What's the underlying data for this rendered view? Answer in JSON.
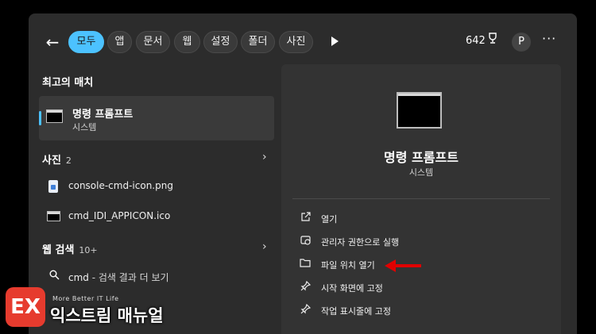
{
  "topbar": {
    "back_label": "←",
    "filters": [
      "모두",
      "앱",
      "문서",
      "웹",
      "설정",
      "폴더",
      "사진"
    ],
    "active_filter": "모두",
    "points": "642",
    "avatar_initial": "P",
    "more_label": "···"
  },
  "left": {
    "best_match_title": "최고의 매치",
    "best_match": {
      "name": "명령 프롬프트",
      "subtitle": "시스템"
    },
    "photos": {
      "title": "사진",
      "count": "2",
      "items": [
        "console-cmd-icon.png",
        "cmd_IDI_APPICON.ico"
      ]
    },
    "web": {
      "title": "웹 검색",
      "count": "10+",
      "query": "cmd",
      "suffix": " - 검색 결과 더 보기"
    }
  },
  "right": {
    "title": "명령 프롬프트",
    "subtitle": "시스템",
    "actions": [
      {
        "icon": "open-external-icon",
        "label": "열기"
      },
      {
        "icon": "admin-shield-icon",
        "label": "관리자 권한으로 실행"
      },
      {
        "icon": "folder-icon",
        "label": "파일 위치 열기"
      },
      {
        "icon": "pin-icon",
        "label": "시작 화면에 고정"
      },
      {
        "icon": "pin-icon",
        "label": "작업 표시줄에 고정"
      }
    ]
  },
  "watermark": {
    "tagline": "More Better IT Life",
    "name": "익스트림 매뉴얼",
    "logo_letter": "EX"
  },
  "colors": {
    "accent": "#4cc2ff",
    "arrow": "#e00000",
    "brand": "#e63b2e"
  }
}
